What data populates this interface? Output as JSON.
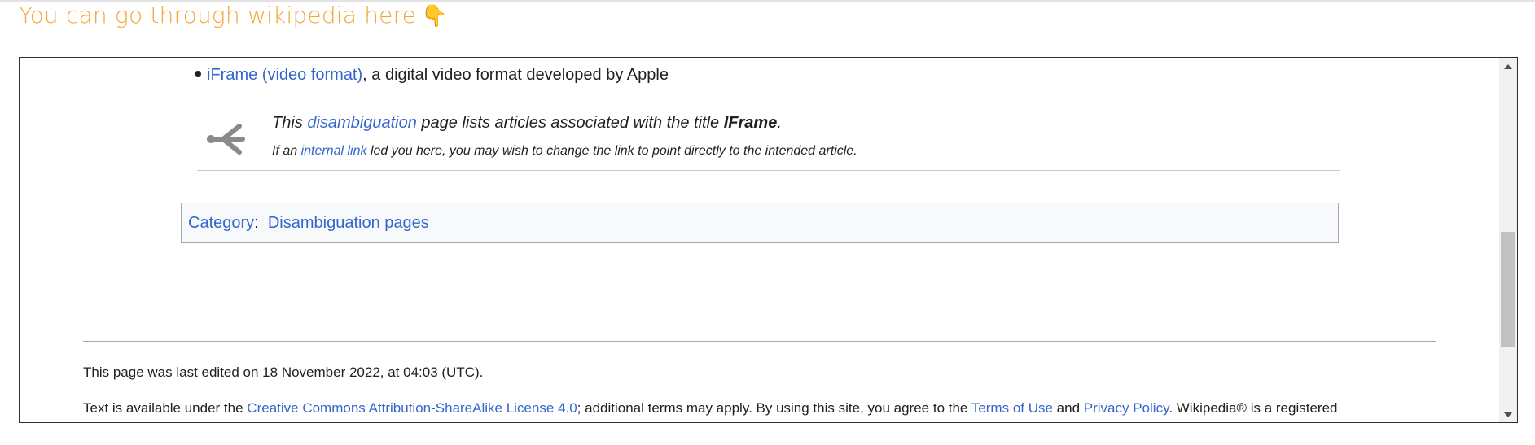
{
  "heading": {
    "text": "You can go through wikipedia here",
    "emoji": "👇"
  },
  "wiki": {
    "bullet": {
      "link": "iFrame (video format)",
      "rest": ", a digital video format developed by Apple"
    },
    "disambig": {
      "icon": "disambiguation-icon",
      "line1_pre": "This ",
      "line1_link": "disambiguation",
      "line1_mid": " page lists articles associated with the title ",
      "line1_title": "IFrame",
      "line1_end": ".",
      "line2_pre": "If an ",
      "line2_link": "internal link",
      "line2_post": " led you here, you may wish to change the link to point directly to the intended article."
    },
    "categories": {
      "label": "Category",
      "sep": ":",
      "items": [
        "Disambiguation pages"
      ]
    },
    "footer": {
      "last_edited": "This page was last edited on 18 November 2022, at 04:03 (UTC).",
      "license_pre": "Text is available under the ",
      "license_link": "Creative Commons Attribution-ShareAlike License 4.0",
      "license_mid": "; additional terms may apply. By using this site, you agree to the ",
      "terms_link": "Terms of Use",
      "and": " and ",
      "privacy_link": "Privacy Policy",
      "license_post": ". Wikipedia® is a registered"
    }
  },
  "colors": {
    "heading": "#f3a738",
    "link": "#3366cc",
    "text": "#202122"
  }
}
